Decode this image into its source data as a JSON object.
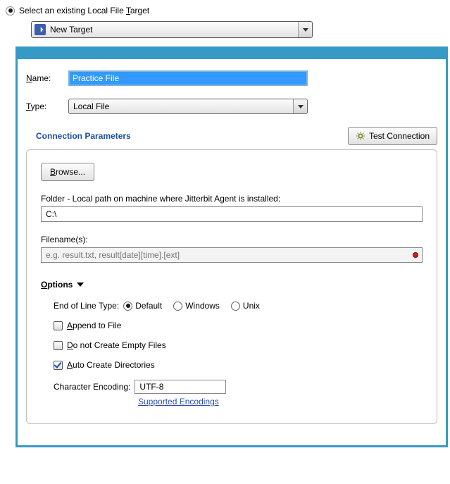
{
  "top": {
    "select_label": "Select an existing Local File Target",
    "target_dropdown": "New Target"
  },
  "form": {
    "name_label": "Name:",
    "name_value": "Practice File",
    "type_label": "Type:",
    "type_value": "Local File"
  },
  "conn": {
    "title": "Connection Parameters",
    "test_label": "Test Connection",
    "browse_label": "Browse...",
    "folder_label": "Folder - Local path on machine where Jitterbit Agent is installed:",
    "folder_value": "C:\\",
    "filenames_label": "Filename(s):",
    "filenames_placeholder": "e.g. result.txt, result[date][time].[ext]"
  },
  "options": {
    "header": "Options",
    "eol_label": "End of Line Type:",
    "eol": {
      "default": "Default",
      "windows": "Windows",
      "unix": "Unix",
      "selected": "default"
    },
    "append_label": "Append to File",
    "noempty_label": "Do not Create Empty Files",
    "autocreate_label": "Auto Create Directories",
    "checkboxes": {
      "append": false,
      "noempty": false,
      "autocreate": true
    },
    "encoding_label": "Character Encoding:",
    "encoding_value": "UTF-8",
    "encodings_link": "Supported Encodings"
  }
}
